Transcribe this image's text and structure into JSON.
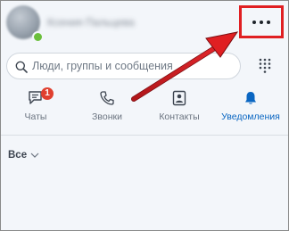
{
  "header": {
    "user_name": "Ксения Пальцева",
    "more_button_label": "..."
  },
  "search": {
    "placeholder": "Люди, группы и сообщения"
  },
  "tabs": [
    {
      "label": "Чаты",
      "badge": "1",
      "icon": "chat-icon"
    },
    {
      "label": "Звонки",
      "icon": "phone-icon"
    },
    {
      "label": "Контакты",
      "icon": "contacts-icon"
    },
    {
      "label": "Уведомления",
      "icon": "bell-icon",
      "active": true
    }
  ],
  "filter": {
    "label": "Все"
  },
  "colors": {
    "accent": "#0a66c2",
    "annotation_red": "#e01f22",
    "badge": "#e0402f",
    "presence": "#6bbf3c"
  }
}
